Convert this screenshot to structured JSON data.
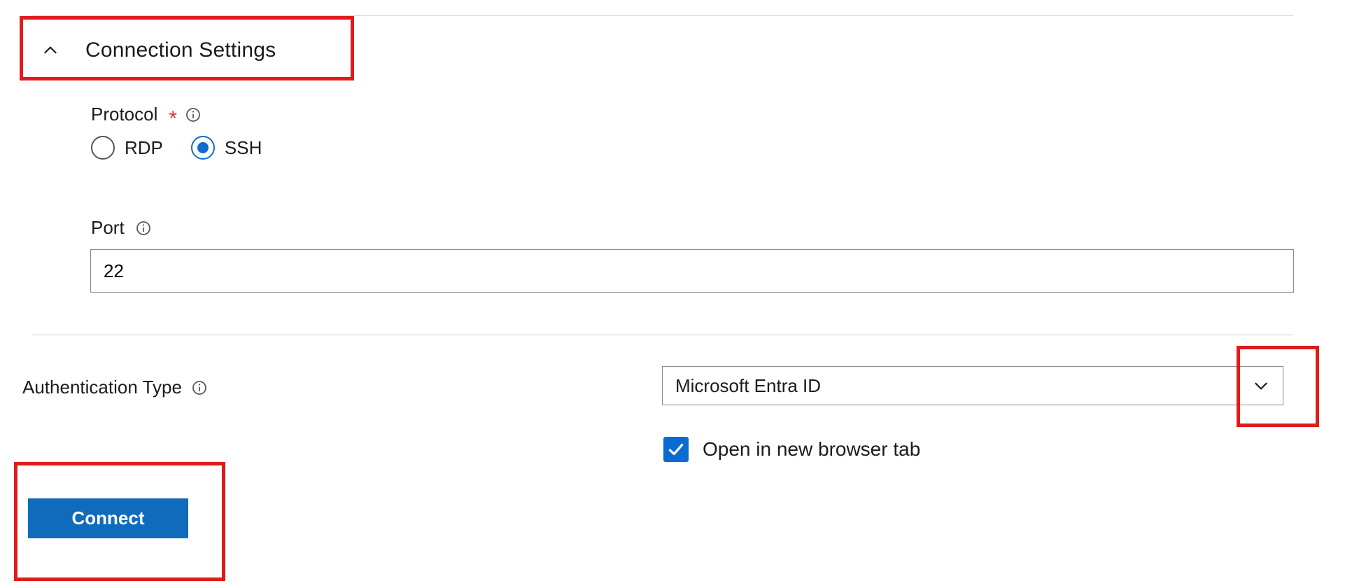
{
  "section": {
    "title": "Connection Settings"
  },
  "protocol": {
    "label": "Protocol",
    "options": {
      "rdp": "RDP",
      "ssh": "SSH"
    },
    "selected": "ssh"
  },
  "port": {
    "label": "Port",
    "value": "22"
  },
  "auth": {
    "label": "Authentication Type",
    "selected": "Microsoft Entra ID"
  },
  "checkbox": {
    "label": "Open in new browser tab",
    "checked": true
  },
  "buttons": {
    "connect": "Connect"
  }
}
